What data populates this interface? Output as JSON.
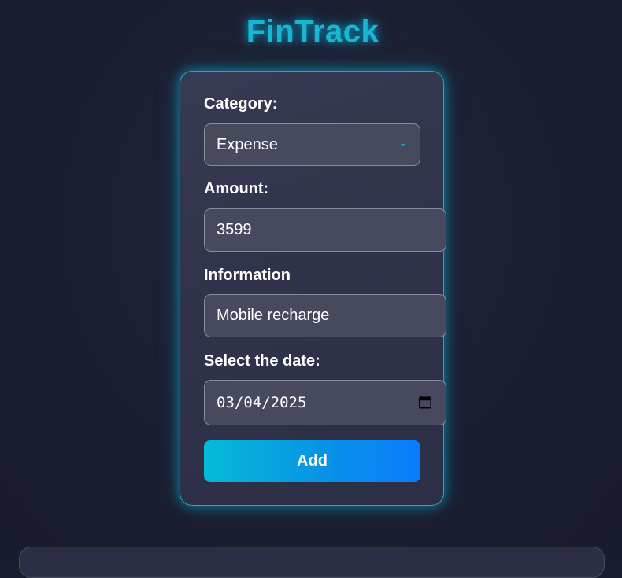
{
  "app": {
    "title": "FinTrack"
  },
  "form": {
    "category": {
      "label": "Category:",
      "value": "Expense",
      "caret_icon": "caret-down-icon"
    },
    "amount": {
      "label": "Amount:",
      "value": "3599"
    },
    "information": {
      "label": "Information",
      "value": "Mobile recharge"
    },
    "date": {
      "label": "Select the date:",
      "value": "03/04/2025",
      "icon": "calendar-icon"
    },
    "add_button": {
      "label": "Add"
    }
  },
  "colors": {
    "accent": "#19b6d2",
    "button_gradient_start": "#05bad6",
    "button_gradient_end": "#0a7cfd",
    "background": "#1b1e30",
    "card": "#31344b",
    "field": "#474a5f"
  }
}
